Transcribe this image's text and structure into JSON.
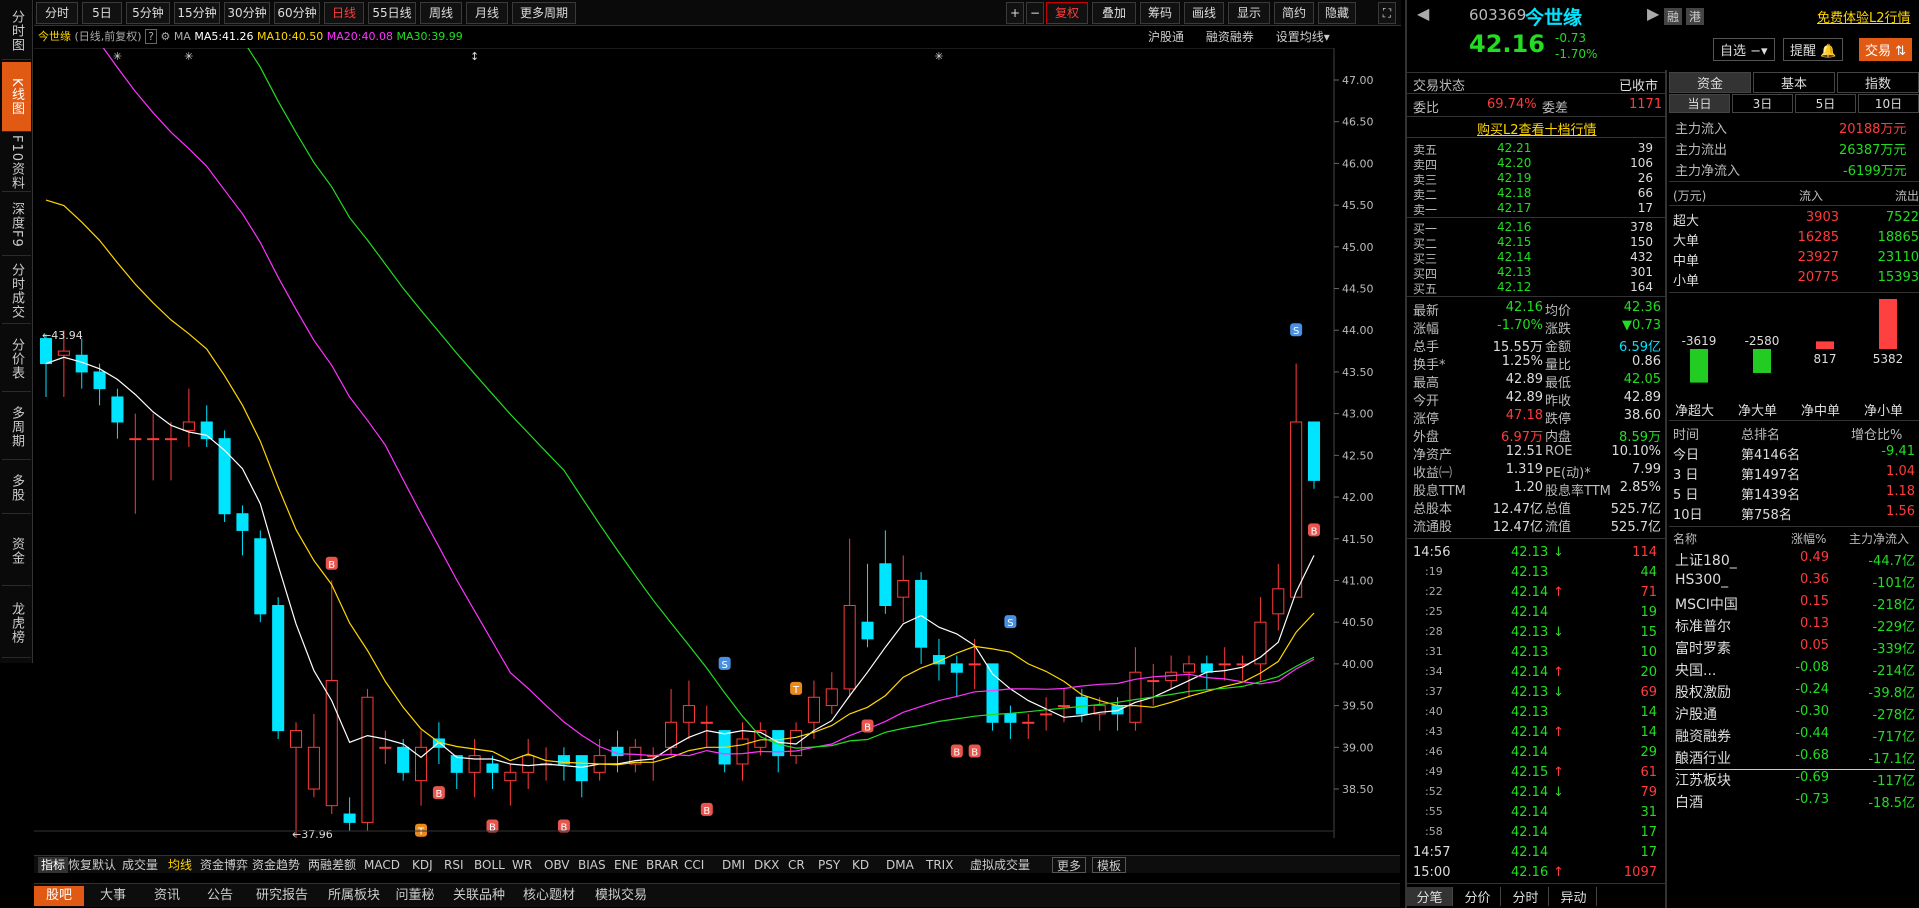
{
  "vtabs": [
    "分时图",
    "K线图",
    "F10资料",
    "深度F9",
    "分时成交",
    "分价表",
    "多周期",
    "多股",
    "资金",
    "龙虎榜"
  ],
  "periods": [
    "分时",
    "5日",
    "5分钟",
    "15分钟",
    "30分钟",
    "60分钟",
    "日线",
    "55日线",
    "周线",
    "月线",
    "更多周期"
  ],
  "tools": [
    "复权",
    "叠加",
    "筹码",
    "画线",
    "显示",
    "简约",
    "隐藏"
  ],
  "legend": {
    "name": "今世缘",
    "desc": "(日线,前复权)",
    "ma_label": "MA",
    "ma5": "MA5:41.26",
    "ma10": "MA10:40.50",
    "ma20": "MA20:40.08",
    "ma30": "MA30:39.99"
  },
  "chart_links": [
    "沪股通",
    "融资融券",
    "设置均线"
  ],
  "colors": {
    "up": "#ff3b3b",
    "down": "#00e5ff",
    "ma5": "#ffffff",
    "ma10": "#ffd700",
    "ma20": "#ff33ff",
    "ma30": "#22dd22"
  },
  "chart_data": {
    "type": "candlestick",
    "ylim": [
      38.0,
      47.2
    ],
    "yticks": [
      "47.00",
      "46.50",
      "46.00",
      "45.50",
      "45.00",
      "44.50",
      "44.00",
      "43.50",
      "43.00",
      "42.50",
      "42.00",
      "41.50",
      "41.00",
      "40.50",
      "40.00",
      "39.50",
      "39.00",
      "38.50"
    ],
    "candles": [
      [
        43.9,
        43.6,
        43.95,
        43.2
      ],
      [
        43.7,
        43.75,
        44.0,
        43.2
      ],
      [
        43.7,
        43.5,
        43.9,
        43.3
      ],
      [
        43.5,
        43.3,
        43.6,
        43.1
      ],
      [
        43.2,
        42.9,
        43.3,
        42.7
      ],
      [
        42.7,
        42.7,
        43.0,
        41.8
      ],
      [
        42.7,
        42.7,
        43.0,
        42.2
      ],
      [
        42.7,
        42.7,
        42.9,
        42.2
      ],
      [
        42.8,
        42.9,
        43.3,
        42.6
      ],
      [
        42.9,
        42.7,
        43.1,
        42.6
      ],
      [
        42.7,
        41.8,
        42.8,
        41.7
      ],
      [
        41.8,
        41.6,
        41.9,
        41.3
      ],
      [
        41.5,
        40.6,
        41.6,
        40.5
      ],
      [
        40.7,
        39.2,
        40.8,
        39.1
      ],
      [
        39.0,
        39.2,
        39.3,
        37.9
      ],
      [
        38.5,
        39.0,
        39.4,
        38.4
      ],
      [
        38.3,
        39.8,
        41.0,
        38.2
      ],
      [
        38.2,
        38.1,
        38.4,
        38.0
      ],
      [
        38.1,
        39.6,
        39.7,
        38.0
      ],
      [
        39.0,
        39.0,
        39.2,
        38.8
      ],
      [
        39.0,
        38.7,
        39.1,
        38.6
      ],
      [
        38.6,
        39.0,
        39.2,
        38.3
      ],
      [
        39.1,
        39.0,
        39.3,
        38.8
      ],
      [
        38.9,
        38.7,
        38.9,
        38.5
      ],
      [
        38.7,
        38.9,
        39.1,
        38.4
      ],
      [
        38.8,
        38.7,
        38.9,
        38.5
      ],
      [
        38.6,
        38.7,
        38.8,
        38.3
      ],
      [
        38.7,
        38.9,
        39.1,
        38.5
      ],
      [
        38.8,
        38.8,
        39.0,
        38.6
      ],
      [
        38.9,
        38.8,
        39.0,
        38.6
      ],
      [
        38.9,
        38.6,
        38.9,
        38.4
      ],
      [
        38.7,
        38.9,
        39.1,
        38.6
      ],
      [
        39.0,
        38.9,
        39.2,
        38.7
      ],
      [
        38.8,
        39.0,
        39.1,
        38.7
      ],
      [
        38.9,
        38.9,
        39.0,
        38.6
      ],
      [
        39.0,
        39.3,
        39.7,
        38.9
      ],
      [
        39.3,
        39.5,
        39.8,
        39.1
      ],
      [
        39.3,
        39.3,
        39.5,
        39.0
      ],
      [
        39.2,
        38.8,
        39.2,
        38.7
      ],
      [
        38.8,
        39.1,
        39.3,
        38.6
      ],
      [
        39.0,
        39.2,
        39.3,
        38.9
      ],
      [
        39.2,
        38.9,
        39.2,
        38.7
      ],
      [
        38.9,
        39.2,
        39.3,
        38.8
      ],
      [
        39.3,
        39.6,
        39.8,
        39.1
      ],
      [
        39.5,
        39.7,
        39.9,
        39.4
      ],
      [
        39.7,
        40.7,
        41.5,
        39.6
      ],
      [
        40.5,
        40.3,
        41.2,
        40.2
      ],
      [
        41.2,
        40.7,
        41.6,
        40.6
      ],
      [
        40.8,
        41.0,
        41.3,
        40.5
      ],
      [
        41.0,
        40.2,
        41.1,
        40.0
      ],
      [
        40.1,
        40.0,
        40.3,
        39.8
      ],
      [
        40.0,
        39.9,
        40.1,
        39.6
      ],
      [
        40.0,
        40.0,
        40.3,
        39.7
      ],
      [
        40.0,
        39.3,
        40.0,
        39.2
      ],
      [
        39.4,
        39.3,
        39.5,
        39.1
      ],
      [
        39.3,
        39.3,
        39.4,
        39.1
      ],
      [
        39.4,
        39.4,
        39.6,
        39.2
      ],
      [
        39.5,
        39.5,
        39.7,
        39.3
      ],
      [
        39.6,
        39.4,
        39.7,
        39.3
      ],
      [
        39.4,
        39.5,
        39.6,
        39.2
      ],
      [
        39.5,
        39.4,
        39.6,
        39.2
      ],
      [
        39.3,
        39.9,
        40.2,
        39.2
      ],
      [
        39.8,
        39.8,
        40.0,
        39.5
      ],
      [
        39.8,
        39.9,
        40.1,
        39.7
      ],
      [
        39.9,
        40.0,
        40.1,
        39.6
      ],
      [
        40.0,
        39.9,
        40.1,
        39.7
      ],
      [
        40.0,
        40.0,
        40.2,
        39.8
      ],
      [
        40.0,
        40.0,
        40.1,
        39.8
      ],
      [
        40.0,
        40.5,
        40.8,
        39.8
      ],
      [
        40.6,
        40.9,
        41.2,
        40.4
      ],
      [
        40.8,
        42.9,
        43.6,
        40.8
      ],
      [
        42.9,
        42.2,
        42.9,
        42.1
      ]
    ]
  },
  "candle_tags": {
    "high_label": "43.94",
    "low_label": "37.96"
  },
  "indicators": [
    "指标",
    "恢复默认",
    "成交量",
    "均线",
    "资金博弈",
    "资金趋势",
    "两融差额",
    "MACD",
    "KDJ",
    "RSI",
    "BOLL",
    "WR",
    "OBV",
    "BIAS",
    "ENE",
    "BRAR",
    "CCI",
    "DMI",
    "DKX",
    "CR",
    "PSY",
    "KD",
    "DMA",
    "TRIX",
    "虚拟成交量",
    "更多",
    "模板"
  ],
  "bottom_tabs": [
    "股吧",
    "大事",
    "资讯",
    "公告",
    "研究报告",
    "所属板块",
    "问董秘",
    "关联品种",
    "核心题材",
    "模拟交易"
  ],
  "quote": {
    "code": "603369",
    "name": "今世缘",
    "price": "42.16",
    "change": "-0.73",
    "pct": "-1.70%",
    "status_label": "交易状态",
    "status": "已收市",
    "ratio_label": "委比",
    "ratio": "69.74%",
    "diff_label": "委差",
    "diff": "1171",
    "l2_link": "购买L2查看十档行情"
  },
  "btns": {
    "zixuan": "自选",
    "remind": "提醒",
    "trade": "交易",
    "rong": "融",
    "gang": "港",
    "free": "免费体验L2行情"
  },
  "asks": [
    [
      "卖五",
      "42.21",
      "39"
    ],
    [
      "卖四",
      "42.20",
      "106"
    ],
    [
      "卖三",
      "42.19",
      "26"
    ],
    [
      "卖二",
      "42.18",
      "66"
    ],
    [
      "卖一",
      "42.17",
      "17"
    ]
  ],
  "bids": [
    [
      "买一",
      "42.16",
      "378"
    ],
    [
      "买二",
      "42.15",
      "150"
    ],
    [
      "买三",
      "42.14",
      "432"
    ],
    [
      "买四",
      "42.13",
      "301"
    ],
    [
      "买五",
      "42.12",
      "164"
    ]
  ],
  "stats": [
    [
      "最新",
      "42.16",
      "均价",
      "42.36"
    ],
    [
      "涨幅",
      "-1.70%",
      "涨跌",
      "▼0.73"
    ],
    [
      "总手",
      "15.55万",
      "金额",
      "6.59亿"
    ],
    [
      "换手*",
      "1.25%",
      "量比",
      "0.86"
    ],
    [
      "最高",
      "42.89",
      "最低",
      "42.05"
    ],
    [
      "今开",
      "42.89",
      "昨收",
      "42.89"
    ],
    [
      "涨停",
      "47.18",
      "跌停",
      "38.60"
    ],
    [
      "外盘",
      "6.97万",
      "内盘",
      "8.59万"
    ],
    [
      "净资产",
      "12.51",
      "ROE",
      "10.10%"
    ],
    [
      "收益㈠",
      "1.319",
      "PE(动)*",
      "7.99"
    ],
    [
      "股息TTM",
      "1.20",
      "股息率TTM",
      "2.85%"
    ],
    [
      "总股本",
      "12.47亿",
      "总值",
      "525.7亿"
    ],
    [
      "流通股",
      "12.47亿",
      "流值",
      "525.7亿"
    ]
  ],
  "ticks": [
    [
      "14:56",
      "42.13",
      "↓",
      "114"
    ],
    [
      ":19",
      "42.13",
      "",
      "44"
    ],
    [
      ":22",
      "42.14",
      "↑",
      "71"
    ],
    [
      ":25",
      "42.14",
      "",
      "19"
    ],
    [
      ":28",
      "42.13",
      "↓",
      "15"
    ],
    [
      ":31",
      "42.13",
      "",
      "10"
    ],
    [
      ":34",
      "42.14",
      "↑",
      "20"
    ],
    [
      ":37",
      "42.13",
      "↓",
      "69"
    ],
    [
      ":40",
      "42.13",
      "",
      "14"
    ],
    [
      ":43",
      "42.14",
      "↑",
      "14"
    ],
    [
      ":46",
      "42.14",
      "",
      "29"
    ],
    [
      ":49",
      "42.15",
      "↑",
      "61"
    ],
    [
      ":52",
      "42.14",
      "↓",
      "79"
    ],
    [
      ":55",
      "42.14",
      "",
      "31"
    ],
    [
      ":58",
      "42.14",
      "",
      "17"
    ],
    [
      "14:57",
      "42.14",
      "",
      "17"
    ],
    [
      "15:00",
      "42.16",
      "↑",
      "1097"
    ]
  ],
  "tick_tabs": [
    "分笔",
    "分价",
    "分时",
    "异动"
  ],
  "fund": {
    "tabs": [
      "资金",
      "基本",
      "指数"
    ],
    "subtabs": [
      "当日",
      "3日",
      "5日",
      "10日"
    ],
    "inflow_label": "主力流入",
    "inflow": "20188万元",
    "outflow_label": "主力流出",
    "outflow": "26387万元",
    "net_label": "主力净流入",
    "net": "-6199万元",
    "table_head": [
      "(万元)",
      "流入",
      "流出"
    ],
    "rows": [
      [
        "超大",
        "3903",
        "7522"
      ],
      [
        "大单",
        "16285",
        "18865"
      ],
      [
        "中单",
        "23927",
        "23110"
      ],
      [
        "小单",
        "20775",
        "15393"
      ]
    ],
    "bar_values": [
      -3619,
      -2580,
      817,
      5382
    ],
    "bar_labels": [
      "-3619",
      "-2580",
      "817",
      "5382"
    ],
    "bar_names": [
      "净超大",
      "净大单",
      "净中单",
      "净小单"
    ]
  },
  "rank": {
    "head": [
      "时间",
      "总排名",
      "增仓比%"
    ],
    "rows": [
      [
        "今日",
        "第4146名",
        "-9.41"
      ],
      [
        "3 日",
        "第1497名",
        "1.04"
      ],
      [
        "5 日",
        "第1439名",
        "1.18"
      ],
      [
        "10日",
        "第758名",
        "1.56"
      ]
    ]
  },
  "sectors": {
    "head": [
      "名称",
      "涨幅%",
      "主力净流入"
    ],
    "rows": [
      [
        "上证180_",
        "0.49",
        "-44.7亿"
      ],
      [
        "HS300_",
        "0.36",
        "-101亿"
      ],
      [
        "MSCI中国",
        "0.15",
        "-218亿"
      ],
      [
        "标准普尔",
        "0.13",
        "-229亿"
      ],
      [
        "富时罗素",
        "0.05",
        "-339亿"
      ],
      [
        "央国...",
        "-0.08",
        "-214亿"
      ],
      [
        "股权激励",
        "-0.24",
        "-39.8亿"
      ],
      [
        "沪股通",
        "-0.30",
        "-278亿"
      ],
      [
        "融资融券",
        "-0.44",
        "-717亿"
      ],
      [
        "酿酒行业",
        "-0.68",
        "-17.1亿"
      ],
      [
        "江苏板块",
        "-0.69",
        "-117亿"
      ],
      [
        "白酒",
        "-0.73",
        "-18.5亿"
      ]
    ]
  }
}
